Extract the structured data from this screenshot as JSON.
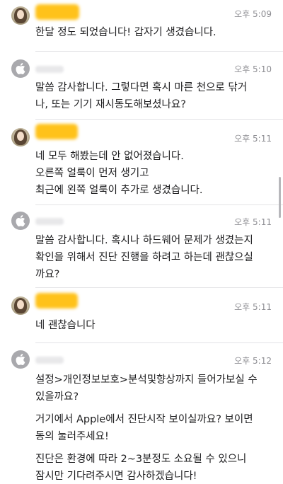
{
  "messages": [
    {
      "sender": "user",
      "time": "오후 5:09",
      "lines": [
        "한달 정도 되었습니다! 갑자기 생겼습니다."
      ]
    },
    {
      "sender": "apple",
      "time": "오후 5:10",
      "lines": [
        "말씀 감사합니다. 그렇다면 혹시 마른 천으로 닦거",
        "나, 또는 기기 재시동도해보셨나요?"
      ]
    },
    {
      "sender": "user",
      "time": "오후 5:11",
      "lines": [
        "네 모두 해봤는데 안 없어졌습니다.",
        "오른쪽 얼룩이 먼저 생기고",
        "최근에 왼쪽 얼룩이 추가로 생겼습니다."
      ]
    },
    {
      "sender": "apple",
      "time": "오후 5:11",
      "lines": [
        "말씀 감사합니다. 혹시나 하드웨어 문제가 생겼는지",
        "확인을 위해서 진단 진행을 하려고 하는데 괜찮으실",
        "까요?"
      ]
    },
    {
      "sender": "user",
      "time": "오후 5:11",
      "lines": [
        "네 괜찮습니다"
      ]
    },
    {
      "sender": "apple",
      "time": "오후 5:12",
      "paragraphs": [
        [
          "설정>개인정보보호>분석및향상까지 들어가보실 수",
          "있을까요?"
        ],
        [
          "거기에서 Apple에서 진단시작 보이실까요? 보이면",
          "동의 눌러주세요!"
        ],
        [
          "진단은 환경에 따라 2~3분정도 소요될 수 있으니",
          "잠시만 기다려주시면 감사하겠습니다!"
        ]
      ]
    }
  ],
  "colors": {
    "text": "#1c1c1e",
    "timestamp": "#8e8e93",
    "name_redaction_user": "#ffc21a",
    "name_redaction_apple": "#e8e8ea",
    "divider": "#e3e3e6"
  },
  "icons": {
    "apple_avatar": "apple-logo-icon",
    "user_avatar": "user-photo-avatar"
  }
}
